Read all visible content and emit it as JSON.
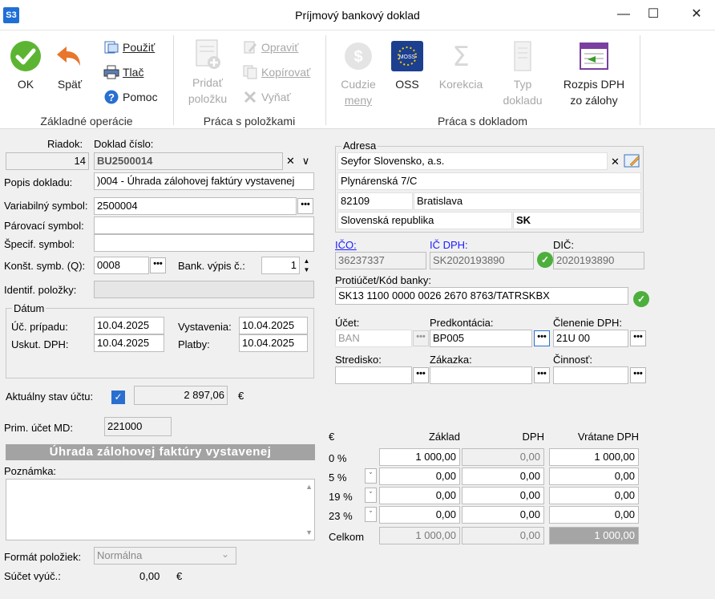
{
  "window": {
    "app_badge": "S3",
    "title": "Príjmový bankový doklad"
  },
  "ribbon": {
    "ok": "OK",
    "back": "Späť",
    "use": "Použiť",
    "print": "Tlač",
    "help": "Pomoc",
    "add_item_1": "Pridať",
    "add_item_2": "položku",
    "edit": "Opraviť",
    "copy": "Kopírovať",
    "remove": "Vyňať",
    "foreign_1": "Cudzie",
    "foreign_2": "meny",
    "oss": "OSS",
    "oss_badge": "MOSS",
    "correction": "Korekcia",
    "type_1": "Typ",
    "type_2": "dokladu",
    "vat_1": "Rozpis DPH",
    "vat_2": "zo zálohy",
    "group_basic": "Základné operácie",
    "group_items": "Práca s položkami",
    "group_doc": "Práca s dokladom"
  },
  "form": {
    "row_label": "Riadok:",
    "row_value": "14",
    "doc_no_label": "Doklad číslo:",
    "doc_no_value": "BU2500014",
    "desc_label": "Popis dokladu:",
    "desc_value": ")004 - Úhrada zálohovej faktúry vystavenej",
    "varsym_label": "Variabilný symbol:",
    "varsym_value": "2500004",
    "pairsym_label": "Párovací symbol:",
    "pairsym_value": "",
    "specsym_label": "Špecif. symbol:",
    "specsym_value": "",
    "constsym_label": "Konšt. symb. (Q):",
    "constsym_value": "0008",
    "bankstmt_label": "Bank. výpis č.:",
    "bankstmt_value": "1",
    "itemid_label": "Identif. položky:",
    "itemid_value": "",
    "date_group": "Dátum",
    "acc_case_label": "Úč. prípadu:",
    "acc_case_value": "10.04.2025",
    "issue_label": "Vystavenia:",
    "issue_value": "10.04.2025",
    "vat_date_label": "Uskut. DPH:",
    "vat_date_value": "10.04.2025",
    "pay_label": "Platby:",
    "pay_value": "10.04.2025",
    "balance_label": "Aktuálny stav účtu:",
    "balance_value": "2 897,06",
    "balance_currency": "€",
    "prim_label": "Prim. účet MD:",
    "prim_value": "221000",
    "banner": "Úhrada zálohovej faktúry vystavenej",
    "note_label": "Poznámka:",
    "format_label": "Formát položiek:",
    "format_value": "Normálna",
    "sum_label": "Súčet vyúč.:",
    "sum_value": "0,00",
    "sum_currency": "€"
  },
  "address": {
    "group": "Adresa",
    "name": "Seyfor Slovensko, a.s.",
    "street": "Plynárenská 7/C",
    "zip": "82109",
    "city": "Bratislava",
    "country": "Slovenská republika",
    "country_code": "SK",
    "ico_label": "IČO:",
    "ico_value": "36237337",
    "icdph_label": "IČ DPH:",
    "icdph_value": "SK2020193890",
    "dic_label": "DIČ:",
    "dic_value": "2020193890",
    "counter_label": "Protiúčet/Kód banky:",
    "counter_value": "SK13 1100 0000 0026 2670 8763/TATRSKBX",
    "account_label": "Účet:",
    "account_value": "BAN",
    "predk_label": "Predkontácia:",
    "predk_value": "BP005",
    "vatsplit_label": "Členenie DPH:",
    "vatsplit_value": "21U 00",
    "center_label": "Stredisko:",
    "order_label": "Zákazka:",
    "activity_label": "Činnosť:"
  },
  "vat_table": {
    "currency": "€",
    "col_base": "Základ",
    "col_vat": "DPH",
    "col_total": "Vrátane DPH",
    "rows": [
      {
        "rate": "0 %",
        "base": "1 000,00",
        "vat": "0,00",
        "total": "1 000,00"
      },
      {
        "rate": "5 %",
        "base": "0,00",
        "vat": "0,00",
        "total": "0,00"
      },
      {
        "rate": "19 %",
        "base": "0,00",
        "vat": "0,00",
        "total": "0,00"
      },
      {
        "rate": "23 %",
        "base": "0,00",
        "vat": "0,00",
        "total": "0,00"
      }
    ],
    "total_label": "Celkom",
    "total_base": "1 000,00",
    "total_vat": "0,00",
    "total_total": "1 000,00"
  }
}
